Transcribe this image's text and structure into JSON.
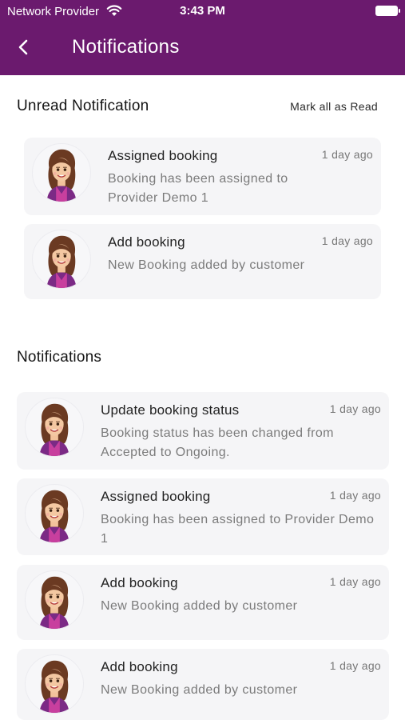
{
  "status_bar": {
    "carrier": "Network Provider",
    "time": "3:43 PM"
  },
  "header": {
    "title": "Notifications",
    "bg_color": "#6b1a6e"
  },
  "unread": {
    "heading": "Unread Notification",
    "mark_all_label": "Mark all as Read",
    "items": [
      {
        "title": "Assigned booking",
        "body": "Booking has been assigned to Provider Demo 1",
        "time": "1 day ago"
      },
      {
        "title": "Add booking",
        "body": "New Booking added by customer",
        "time": "1 day ago"
      }
    ]
  },
  "notifications": {
    "heading": "Notifications",
    "items": [
      {
        "title": "Update booking status",
        "body": "Booking status has been changed from Accepted to Ongoing.",
        "time": "1 day ago"
      },
      {
        "title": "Assigned booking",
        "body": "Booking has been assigned to Provider Demo 1",
        "time": "1 day ago"
      },
      {
        "title": "Add booking",
        "body": "New Booking added by customer",
        "time": "1 day ago"
      },
      {
        "title": "Add booking",
        "body": "New Booking added by customer",
        "time": "1 day ago"
      }
    ]
  },
  "icons": {
    "back": "chevron-left-icon",
    "wifi": "wifi-icon",
    "battery": "battery-icon",
    "avatar": "user-avatar"
  }
}
